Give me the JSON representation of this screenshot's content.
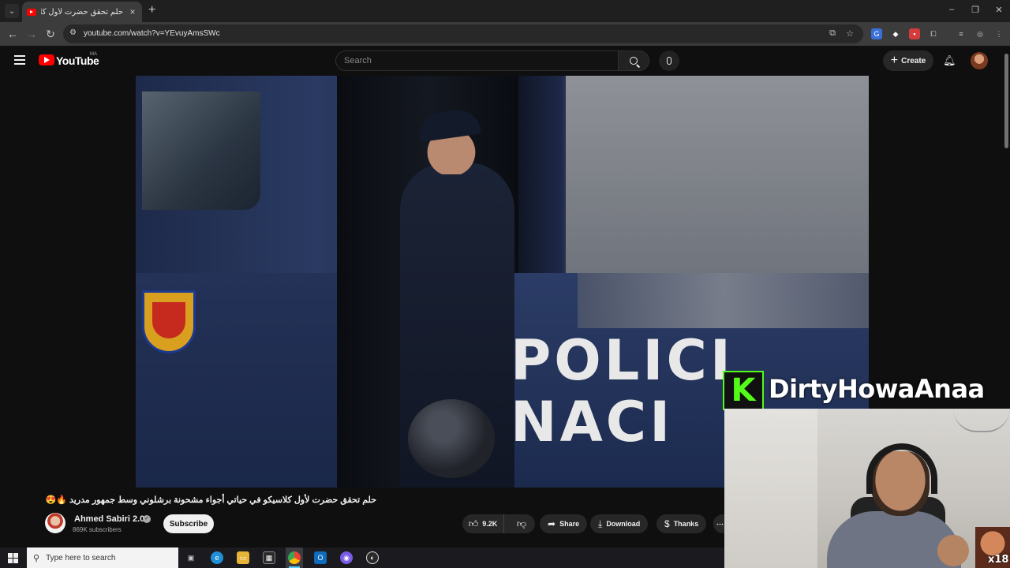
{
  "browser": {
    "tab_title": "حلم تحقق حضرت لأول كلاسيكو ...",
    "url": "youtube.com/watch?v=YEvuyAmsSWc",
    "new_tab": "+",
    "window_controls": {
      "minimize": "–",
      "maximize": "❐",
      "close": "✕"
    }
  },
  "youtube": {
    "logo_text": "YouTube",
    "country": "MA",
    "search_placeholder": "Search",
    "create_label": "Create"
  },
  "video": {
    "overlay_line1": "POLICI",
    "overlay_line2": "NACI",
    "title": "حلم تحقق حضرت لأول كلاسيكو في حياتي أجواء مشحونة برشلوني وسط جمهور مدريد 🔥😍",
    "channel_name": "Ahmed Sabiri 2.0",
    "subscribers": "869K subscribers",
    "subscribe_label": "Subscribe",
    "likes": "9.2K",
    "share_label": "Share",
    "download_label": "Download",
    "thanks_label": "Thanks",
    "more_label": "⋯"
  },
  "stream_overlay": {
    "platform_logo": "K",
    "streamer_name": "DirtyHowaAnaa",
    "badge_text": "x18"
  },
  "taskbar": {
    "search_placeholder": "Type here to search"
  },
  "colors": {
    "yt_red": "#ff0000",
    "kick_green": "#53fc18",
    "background": "#0f0f0f"
  }
}
